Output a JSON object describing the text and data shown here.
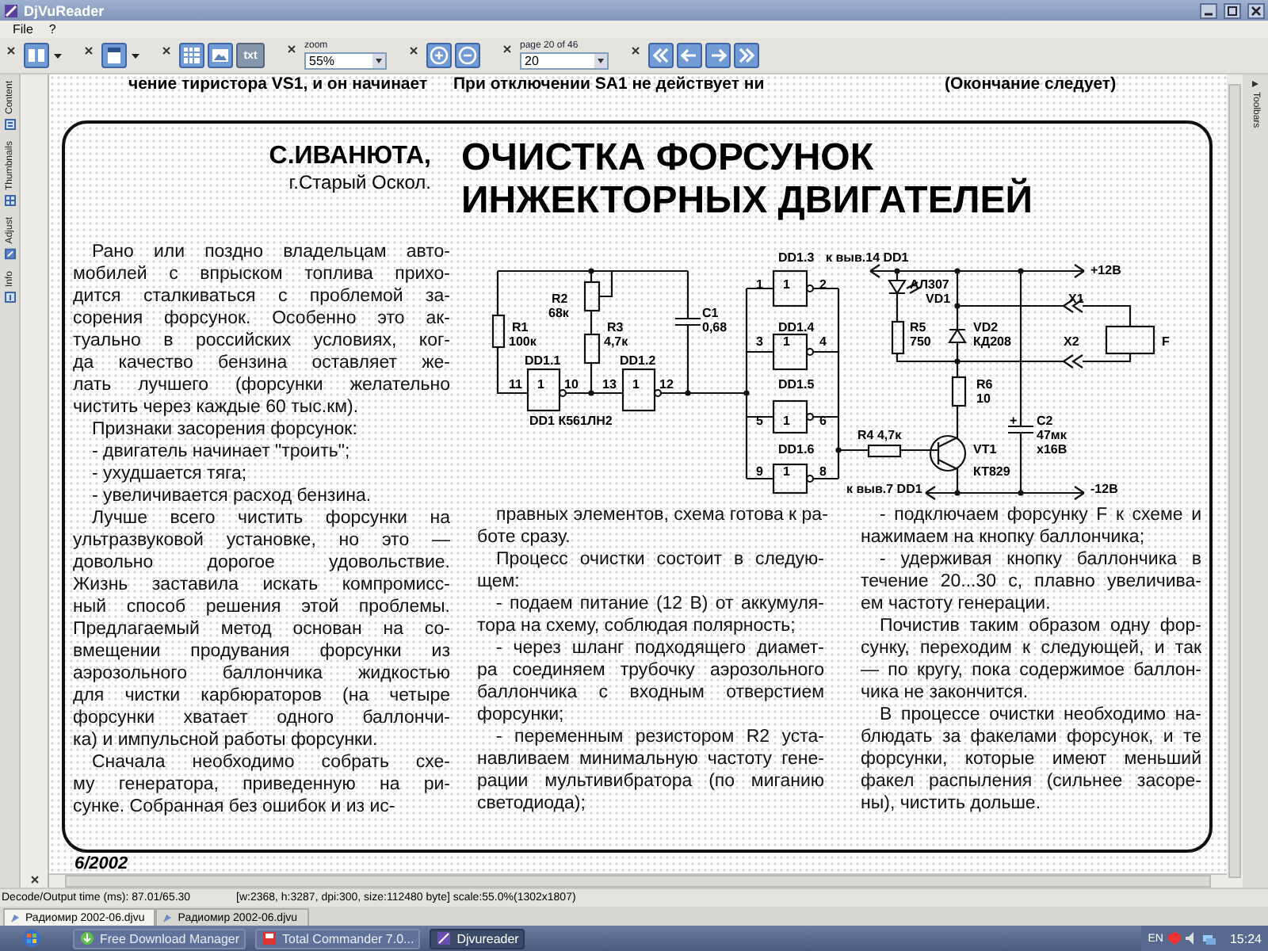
{
  "window": {
    "title": "DjVuReader"
  },
  "menu": [
    "File",
    "?"
  ],
  "toolbar": {
    "text_button": "txt",
    "zoom_label": "zoom",
    "zoom_value": "55%",
    "page_label": "page 20 of 46",
    "page_value": "20"
  },
  "sidebar": {
    "tabs": [
      "Content",
      "Thumbnails",
      "Adjust",
      "Info"
    ]
  },
  "right_panel": {
    "tab": "Toolbars"
  },
  "document": {
    "top_line": [
      "чение тиристора VS1, и он начинает",
      "При отключении SA1 не действует ни",
      "(Окончание следует)"
    ],
    "article": {
      "author": "С.ИВАНЮТА,",
      "city": "г.Старый Оскол.",
      "title": [
        "ОЧИСТКА ФОРСУНОК",
        "ИНЖЕКТОРНЫХ ДВИГАТЕЛЕЙ"
      ],
      "left_column": [
        {
          "lines": [
            "Рано или поздно владельцам авто-",
            "мобилей с впрыском топлива прихо-",
            "дится сталкиваться с проблемой за-",
            "сорения форсунок. Особенно это ак-",
            "туально в российских условиях, ког-",
            "да качество бензина оставляет же-",
            "лать лучшего (форсунки желательно",
            "чистить через каждые 60 тыс.км)."
          ]
        },
        {
          "lines": [
            "Признаки засорения форсунок:"
          ]
        },
        {
          "lines": [
            "- двигатель начинает \"троить\";"
          ]
        },
        {
          "lines": [
            "- ухудшается тяга;"
          ]
        },
        {
          "lines": [
            "- увеличивается расход бензина."
          ]
        },
        {
          "lines": [
            "Лучше всего чистить форсунки на",
            "ультразвуковой установке, но это —",
            "довольно дорогое удовольствие.",
            "Жизнь заставила искать компромисс-",
            "ный способ решения этой проблемы.",
            "Предлагаемый метод основан на со-",
            "вмещении продувания форсунки из",
            "аэрозольного баллончика жидкостью",
            "для чистки карбюраторов (на четыре",
            "форсунки хватает одного баллончи-",
            "ка) и импульсной работы форсунки."
          ]
        },
        {
          "lines": [
            "Сначала необходимо собрать схе-",
            "му генератора, приведенную на ри-",
            "сунке. Собранная без ошибок и из ис-"
          ]
        }
      ],
      "middle_column": [
        {
          "lines": [
            "правных элементов, схема готова к ра-",
            "боте сразу."
          ]
        },
        {
          "lines": [
            "Процесс очистки состоит в следую-",
            "щем:"
          ]
        },
        {
          "lines": [
            "- подаем питание (12 В) от аккумуля-",
            "тора на схему, соблюдая полярность;"
          ]
        },
        {
          "lines": [
            "- через шланг подходящего диамет-",
            "ра соединяем трубочку аэрозольного",
            "баллончика с входным отверстием",
            "форсунки;"
          ]
        },
        {
          "lines": [
            "- переменным резистором R2 уста-",
            "навливаем минимальную частоту гене-",
            "рации мультивибратора (по миганию",
            "светодиода);"
          ]
        }
      ],
      "right_column": [
        {
          "lines": [
            "- подключаем форсунку F к схеме и",
            "нажимаем на кнопку баллончика;"
          ]
        },
        {
          "lines": [
            "- удерживая кнопку баллончика в",
            "течение 20...30 с, плавно увеличива-",
            "ем частоту генерации."
          ]
        },
        {
          "lines": [
            "Почистив таким образом одну фор-",
            "сунку, переходим к следующей, и так",
            "— по кругу, пока содержимое баллон-",
            "чика не закончится."
          ]
        },
        {
          "lines": [
            "В процессе очистки необходимо на-",
            "блюдать за факелами форсунок, и те",
            "форсунки, которые имеют меньший",
            "факел распыления (сильнее засоре-",
            "ны), чистить дольше."
          ]
        }
      ],
      "circuit_labels": [
        "DD1.3",
        "к выв.14 DD1",
        "+12В",
        "1",
        "1",
        "2",
        "АЛ307",
        "R2",
        "VD1",
        "X1",
        "68к",
        "C1",
        "R1",
        "R3",
        "0,68",
        "DD1.4",
        "R5",
        "VD2",
        "100к",
        "4,7к",
        "3",
        "1",
        "4",
        "750",
        "КД208",
        "X2",
        "F",
        "DD1.1",
        "DD1.2",
        "11",
        "1",
        "10",
        "13",
        "1",
        "12",
        "DD1.5",
        "R6",
        "10",
        "DD1 К561ЛН2",
        "5",
        "1",
        "6",
        "+",
        "C2",
        "R4 4,7к",
        "47мк",
        "DD1.6",
        "VT1",
        "х16В",
        "9",
        "1",
        "8",
        "КТ829",
        "к выв.7 DD1",
        "-12В"
      ]
    },
    "footer": "6/2002"
  },
  "status_bar": {
    "timing": "Decode/Output time (ms): 87.01/65.30",
    "info": "[w:2368, h:3287, dpi:300, size:112480 byte] scale:55.0%(1302x1807)"
  },
  "document_tabs": [
    {
      "label": "Радиомир 2002-06.djvu",
      "selected": true
    },
    {
      "label": "Радиомир 2002-06.djvu",
      "selected": false
    }
  ],
  "taskbar": {
    "items": [
      {
        "label": "Free Download Manager",
        "selected": false
      },
      {
        "label": "Total Commander 7.0...",
        "selected": false
      },
      {
        "label": "Djvureader",
        "selected": true
      }
    ],
    "language": "EN",
    "clock": "15:24"
  }
}
